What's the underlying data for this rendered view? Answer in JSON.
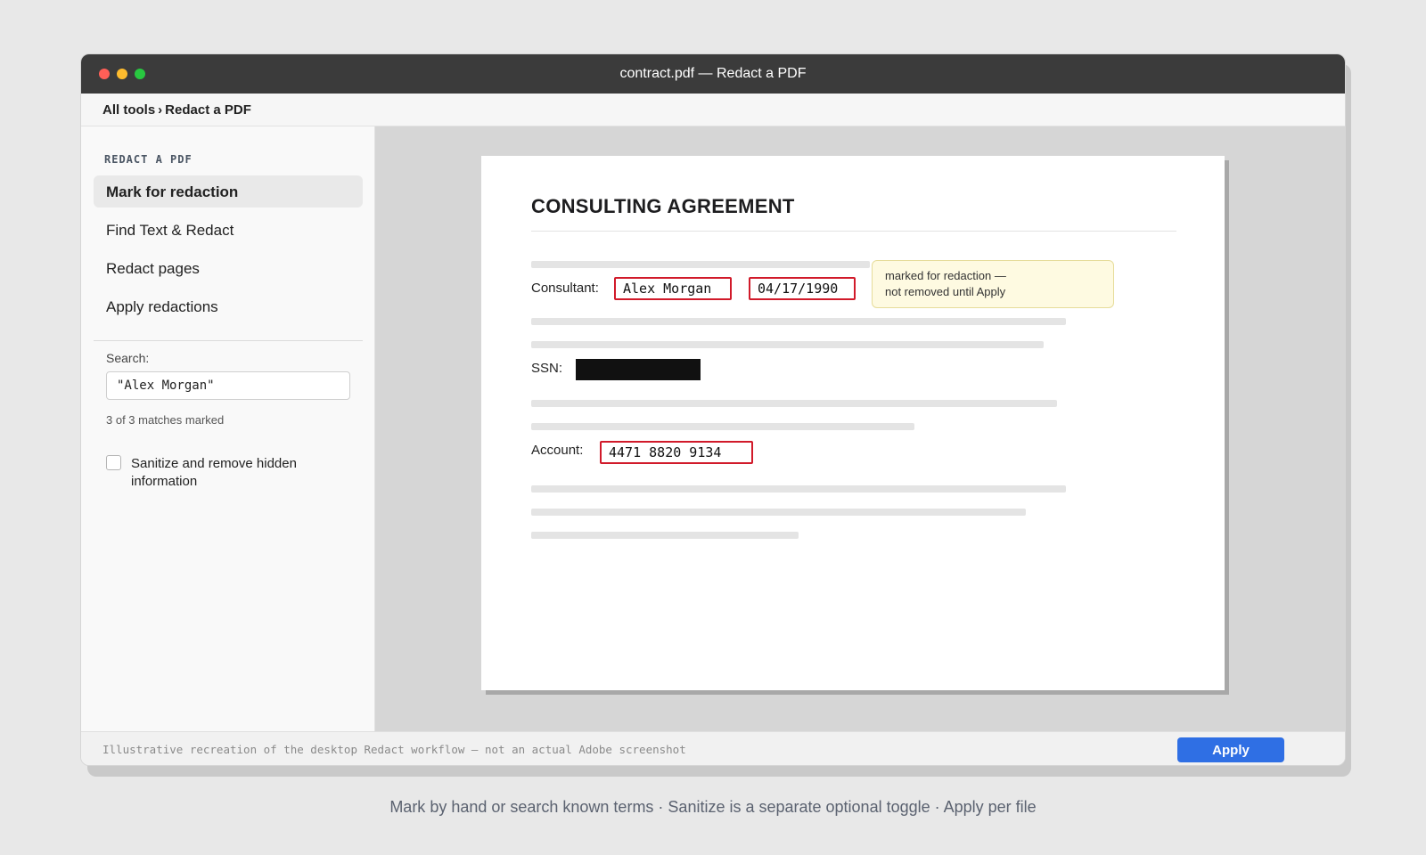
{
  "window": {
    "title": "contract.pdf — Redact a PDF"
  },
  "breadcrumb": {
    "root": "All tools",
    "separator": "›",
    "current": "Redact a PDF"
  },
  "sidebar": {
    "heading": "REDACT A PDF",
    "items": [
      {
        "label": "Mark for redaction",
        "active": true
      },
      {
        "label": "Find Text & Redact",
        "active": false
      },
      {
        "label": "Redact pages",
        "active": false
      },
      {
        "label": "Apply redactions",
        "active": false
      }
    ],
    "search": {
      "label": "Search:",
      "value": "\"Alex Morgan\""
    },
    "matches": "3 of 3 matches marked",
    "sanitize": {
      "label": "Sanitize and remove hidden information",
      "checked": false
    }
  },
  "document": {
    "title": "CONSULTING AGREEMENT",
    "fields": {
      "consultant_label": "Consultant:",
      "consultant_name": "Alex Morgan",
      "consultant_dob": "04/17/1990",
      "ssn_label": "SSN:",
      "account_label": "Account:",
      "account_number": "4471 8820 9134"
    },
    "tooltip": {
      "line1": "marked for redaction —",
      "line2": "not removed until Apply"
    }
  },
  "footer": {
    "note": "Illustrative recreation of the desktop Redact workflow — not an actual Adobe screenshot",
    "apply_label": "Apply"
  },
  "caption": "Mark by hand or search known terms · Sanitize is a separate optional toggle · Apply per file",
  "colors": {
    "accent": "#2f6fe4",
    "redaction_mark": "#d11a2a",
    "redacted_fill": "#111111",
    "tooltip_bg": "#fefae1"
  }
}
